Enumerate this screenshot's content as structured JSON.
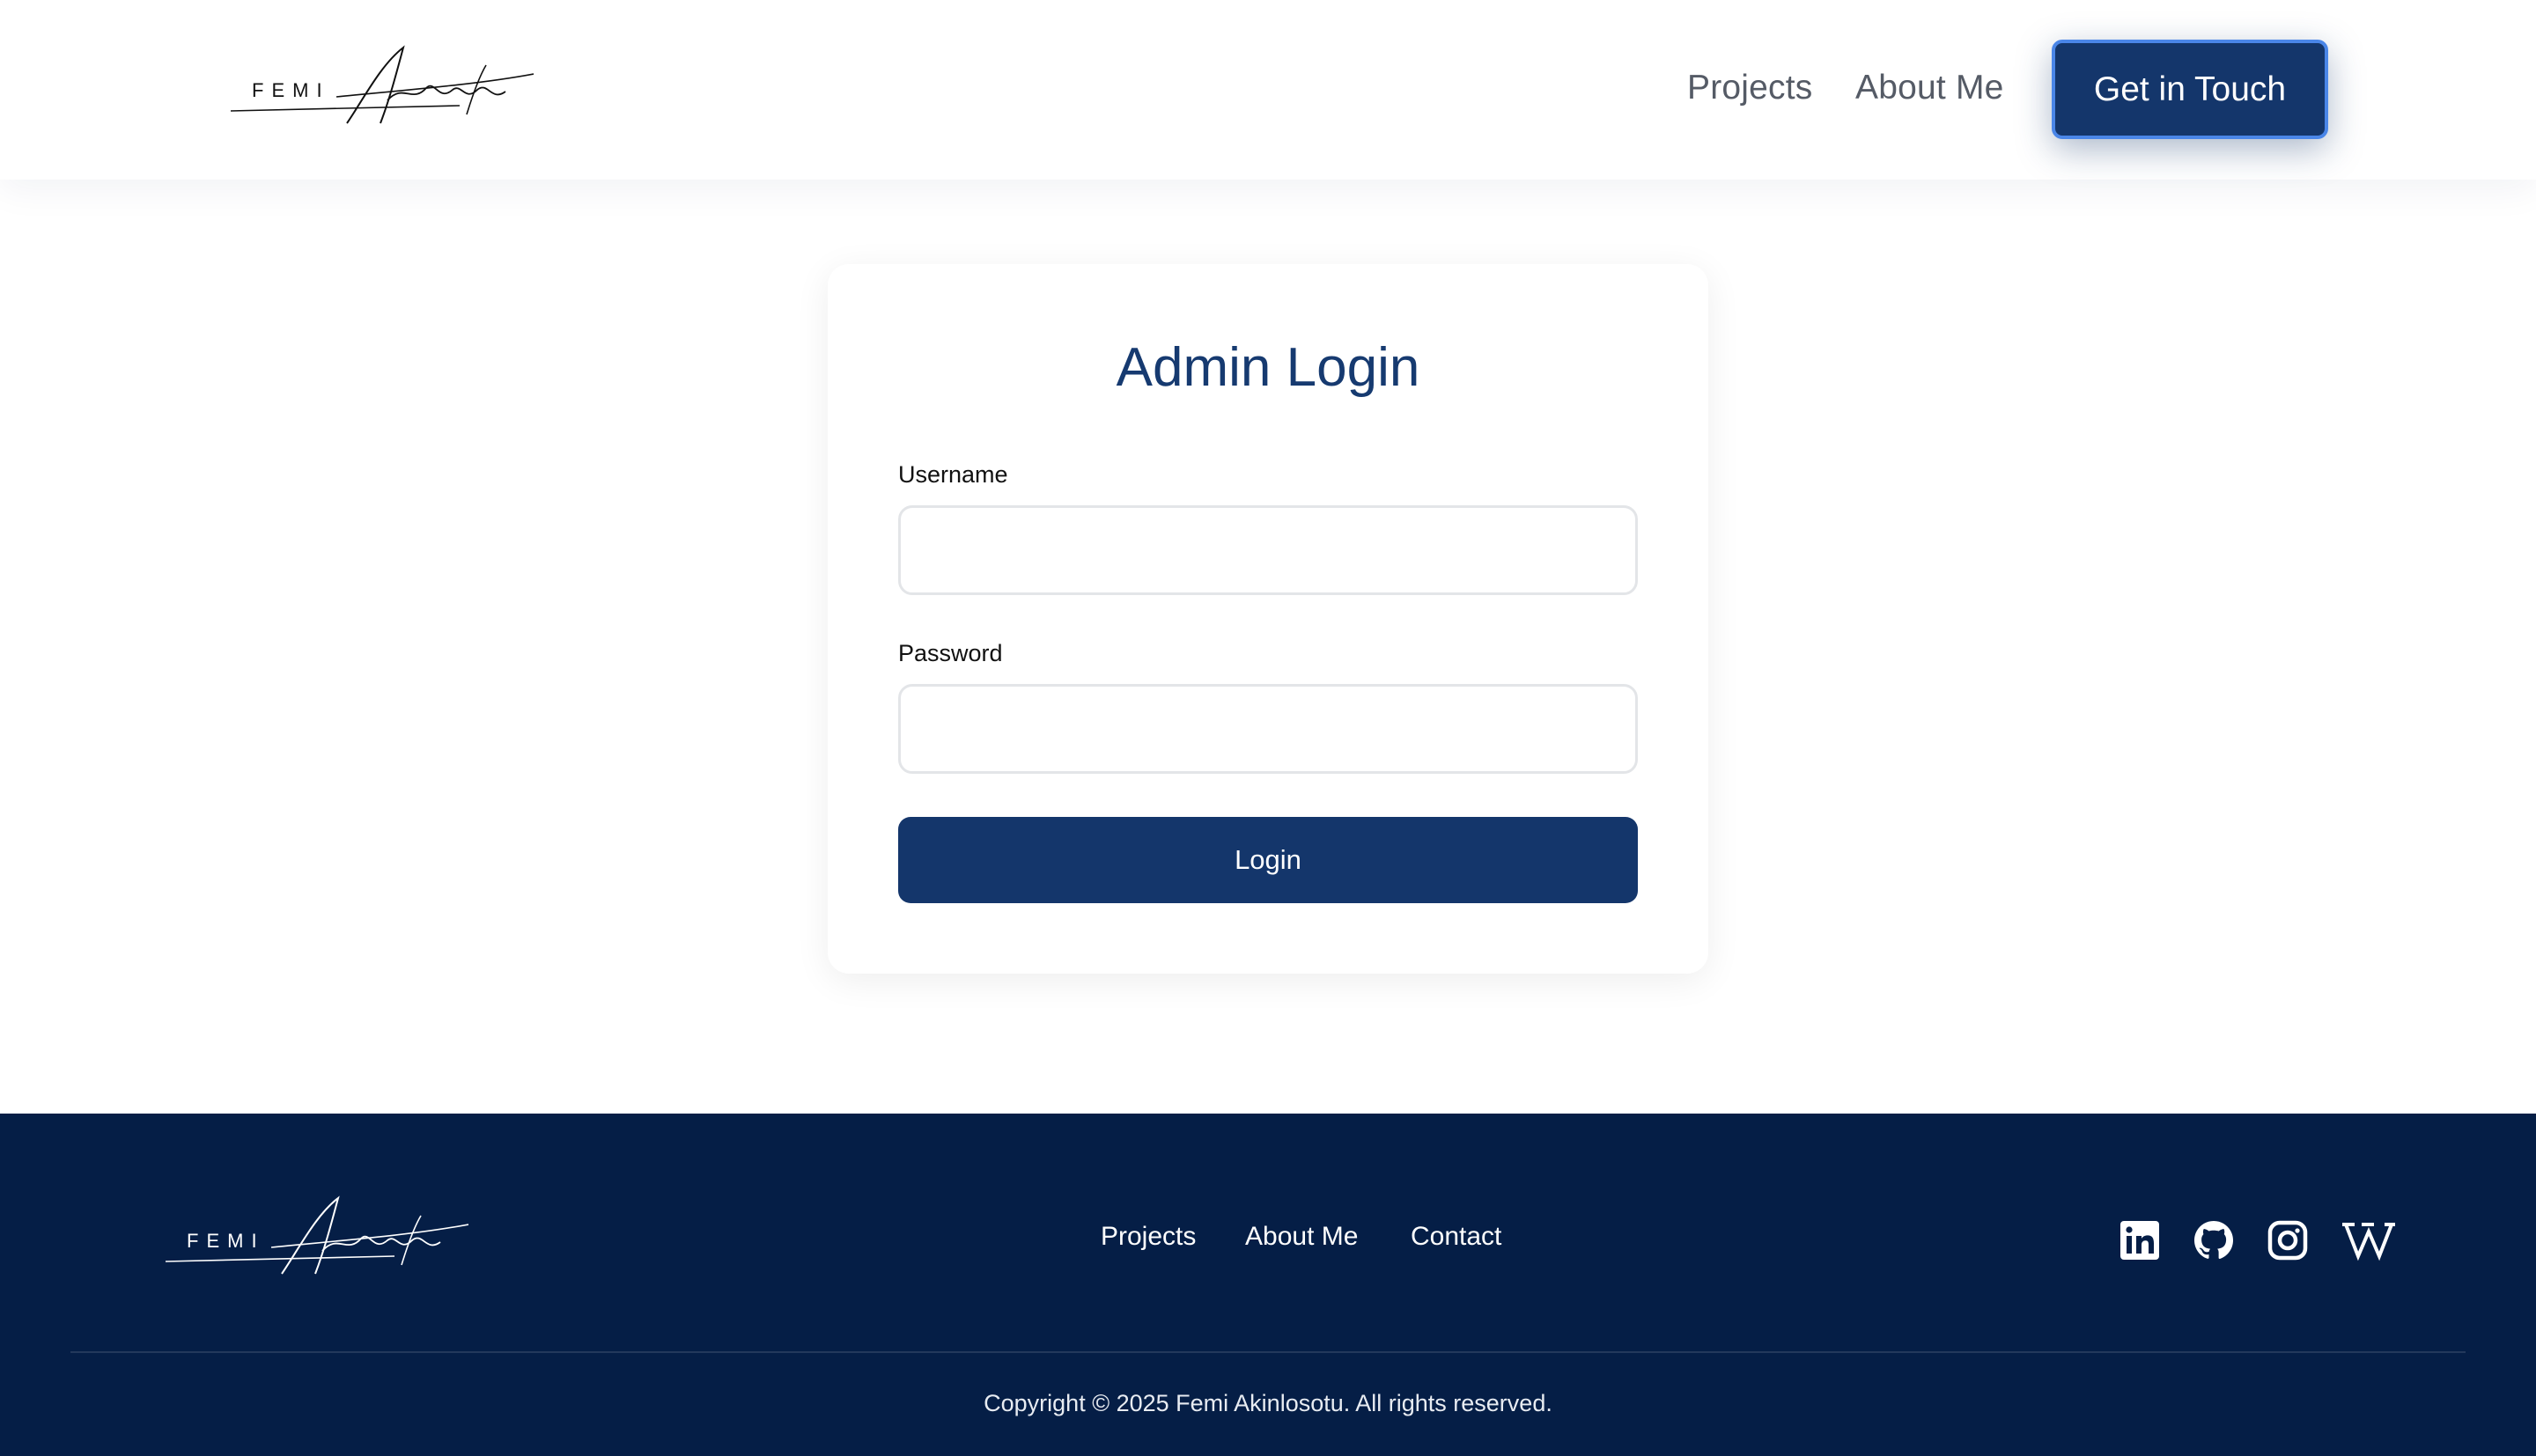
{
  "header": {
    "logo": {
      "first": "FEMI",
      "last": "Akinlosotu"
    },
    "nav": [
      {
        "label": "Projects"
      },
      {
        "label": "About Me"
      }
    ],
    "cta_label": "Get in Touch"
  },
  "login": {
    "title": "Admin Login",
    "username_label": "Username",
    "username_value": "",
    "password_label": "Password",
    "password_value": "",
    "button_label": "Login"
  },
  "footer": {
    "logo": {
      "first": "FEMI",
      "last": "Akinlosotu"
    },
    "nav": [
      {
        "label": "Projects"
      },
      {
        "label": "About Me"
      },
      {
        "label": "Contact"
      }
    ],
    "socials": [
      {
        "icon": "linkedin-icon"
      },
      {
        "icon": "github-icon"
      },
      {
        "icon": "instagram-icon"
      },
      {
        "icon": "wikipedia-icon"
      }
    ],
    "copyright": "Copyright © 2025 Femi Akinlosotu. All rights reserved."
  },
  "colors": {
    "primary": "#14366b",
    "footer_bg": "#051e46",
    "cta_border": "#4a86e8",
    "title": "#163a70"
  }
}
